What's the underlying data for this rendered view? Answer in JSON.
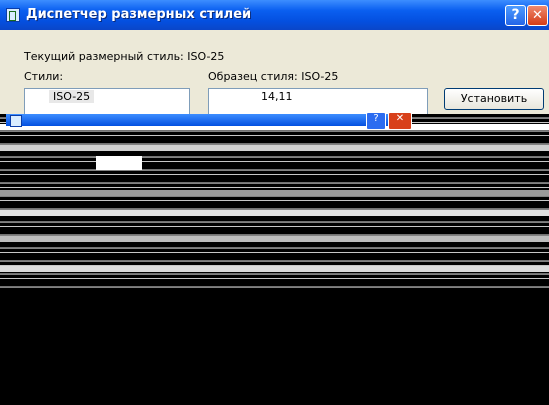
{
  "window": {
    "title": "Диспетчер размерных стилей",
    "help_label": "?",
    "close_label": "✕",
    "current_style_label": "Текущий размерный стиль: ISO-25",
    "styles_label": "Стили:",
    "styles_list": [
      "ISO-25"
    ],
    "preview_label": "Образец стиля: ISO-25",
    "preview_dimension": "14,11",
    "set_current_button": "Установить"
  },
  "inner_dialog": {
    "help_label": "?",
    "close_label": "✕"
  },
  "colors": {
    "title_bar": "#0a5ff0",
    "dialog_bg": "#ece9d8",
    "close_button": "#d43c16"
  }
}
